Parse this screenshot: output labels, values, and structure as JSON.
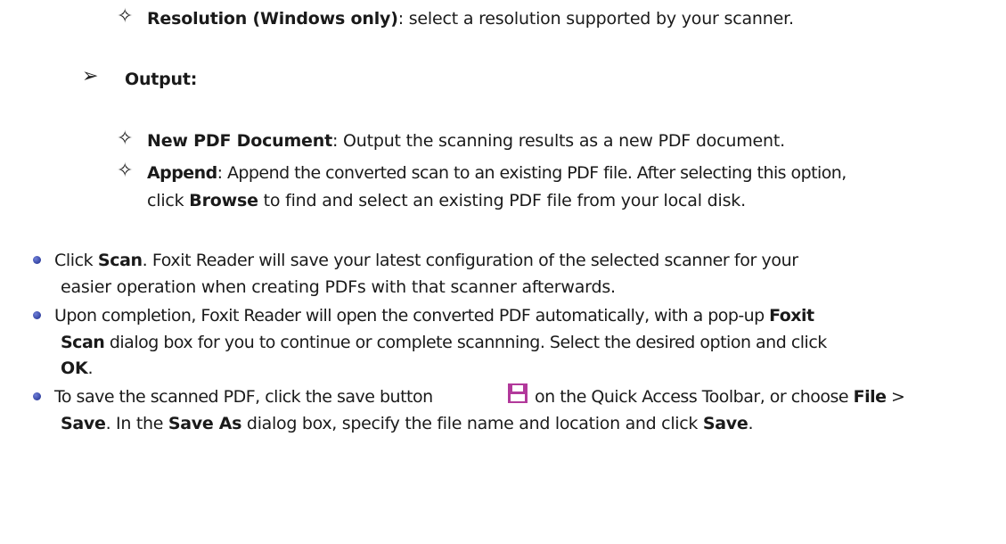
{
  "resolution": {
    "label": "Resolution (Windows only)",
    "text": ": select a resolution supported by your scanner."
  },
  "output": {
    "label": "Output:"
  },
  "new_pdf": {
    "label": "New PDF Document",
    "text": ": Output the scanning results as a new PDF document."
  },
  "append": {
    "label": "Append",
    "text1": ": Append the converted scan to an existing PDF file. After selecting this option,",
    "text2_pre": "click ",
    "browse": "Browse",
    "text2_post": " to find and select an existing PDF file from your local disk."
  },
  "scan": {
    "pre": "Click ",
    "scan_label": "Scan",
    "post1": ". Foxit Reader will save your latest configuration of the selected scanner for your",
    "line2": "easier operation when creating PDFs with that scanner afterwards."
  },
  "completion": {
    "line1_pre": "Upon completion, Foxit Reader will open the converted PDF automatically, with a pop-up ",
    "foxit": "Foxit",
    "scan_label": "Scan",
    "line2_post": " dialog box for you to continue or complete scannning. Select the desired option and click",
    "ok": "OK",
    "period": "."
  },
  "save": {
    "line1_pre": "To save the scanned PDF, click the save button ",
    "line1_mid": " on the Quick Access Toolbar, or choose ",
    "file": "File",
    "gt": " >",
    "save_label": "Save",
    "line2_a": ". In the ",
    "save_as": "Save As",
    "line2_b": " dialog box, specify the file name and location and click ",
    "save_label2": "Save",
    "period": "."
  },
  "icons": {
    "diamond": "four-pointed-star-icon",
    "arrow": "arrowhead-icon",
    "bullet": "blue-dot-bullet-icon",
    "save": "floppy-disk-save-icon"
  },
  "colors": {
    "bullet": "#1a2a8a",
    "save_icon": "#b2399b"
  }
}
